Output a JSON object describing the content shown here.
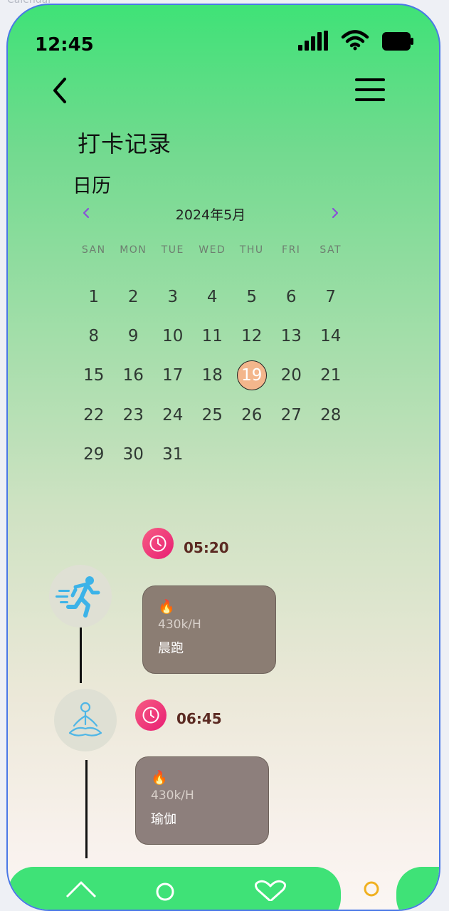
{
  "window": {
    "caption": "Calendar"
  },
  "status_bar": {
    "time": "12:45"
  },
  "page": {
    "title": "打卡记录",
    "subtitle": "日历"
  },
  "calendar": {
    "month_label": "2024年5月",
    "weekdays": [
      "SAN",
      "MON",
      "TUE",
      "WED",
      "THU",
      "FRI",
      "SAT"
    ],
    "days": [
      "1",
      "2",
      "3",
      "4",
      "5",
      "6",
      "7",
      "8",
      "9",
      "10",
      "11",
      "12",
      "13",
      "14",
      "15",
      "16",
      "17",
      "18",
      "19",
      "20",
      "21",
      "22",
      "23",
      "24",
      "25",
      "26",
      "27",
      "28",
      "29",
      "30",
      "31"
    ],
    "selected_day": "19"
  },
  "records": [
    {
      "time": "05:20",
      "rate": "430k/H",
      "activity": "晨跑",
      "activity_icon": "running-icon"
    },
    {
      "time": "06:45",
      "rate": "430k/H",
      "activity": "瑜伽",
      "activity_icon": "yoga-icon"
    }
  ],
  "tab_bar": {
    "icons": [
      "home-icon",
      "user-icon",
      "heart-icon",
      "profile-icon"
    ]
  },
  "colors": {
    "accent_green": "#3fe277",
    "selected_day": "#f3b68c",
    "clock_pink": "#e91e74",
    "card_1": "#8b7d73",
    "card_2": "#8d7f7c",
    "nav_arrow": "#8a4fd8",
    "active_tab": "#f0b020"
  }
}
